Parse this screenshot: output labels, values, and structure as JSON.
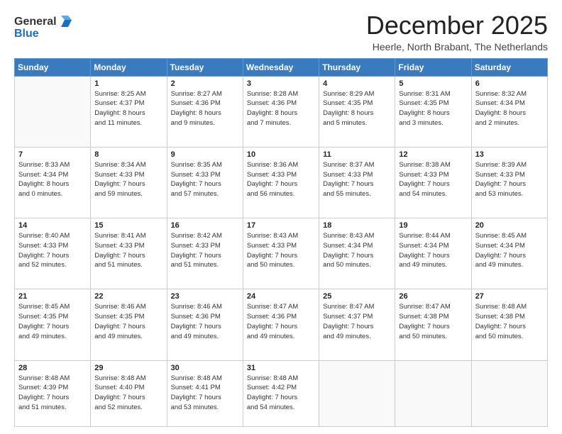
{
  "header": {
    "logo_general": "General",
    "logo_blue": "Blue",
    "month_title": "December 2025",
    "location": "Heerle, North Brabant, The Netherlands"
  },
  "weekdays": [
    "Sunday",
    "Monday",
    "Tuesday",
    "Wednesday",
    "Thursday",
    "Friday",
    "Saturday"
  ],
  "weeks": [
    [
      {
        "day": "",
        "info": ""
      },
      {
        "day": "1",
        "info": "Sunrise: 8:25 AM\nSunset: 4:37 PM\nDaylight: 8 hours\nand 11 minutes."
      },
      {
        "day": "2",
        "info": "Sunrise: 8:27 AM\nSunset: 4:36 PM\nDaylight: 8 hours\nand 9 minutes."
      },
      {
        "day": "3",
        "info": "Sunrise: 8:28 AM\nSunset: 4:36 PM\nDaylight: 8 hours\nand 7 minutes."
      },
      {
        "day": "4",
        "info": "Sunrise: 8:29 AM\nSunset: 4:35 PM\nDaylight: 8 hours\nand 5 minutes."
      },
      {
        "day": "5",
        "info": "Sunrise: 8:31 AM\nSunset: 4:35 PM\nDaylight: 8 hours\nand 3 minutes."
      },
      {
        "day": "6",
        "info": "Sunrise: 8:32 AM\nSunset: 4:34 PM\nDaylight: 8 hours\nand 2 minutes."
      }
    ],
    [
      {
        "day": "7",
        "info": "Sunrise: 8:33 AM\nSunset: 4:34 PM\nDaylight: 8 hours\nand 0 minutes."
      },
      {
        "day": "8",
        "info": "Sunrise: 8:34 AM\nSunset: 4:33 PM\nDaylight: 7 hours\nand 59 minutes."
      },
      {
        "day": "9",
        "info": "Sunrise: 8:35 AM\nSunset: 4:33 PM\nDaylight: 7 hours\nand 57 minutes."
      },
      {
        "day": "10",
        "info": "Sunrise: 8:36 AM\nSunset: 4:33 PM\nDaylight: 7 hours\nand 56 minutes."
      },
      {
        "day": "11",
        "info": "Sunrise: 8:37 AM\nSunset: 4:33 PM\nDaylight: 7 hours\nand 55 minutes."
      },
      {
        "day": "12",
        "info": "Sunrise: 8:38 AM\nSunset: 4:33 PM\nDaylight: 7 hours\nand 54 minutes."
      },
      {
        "day": "13",
        "info": "Sunrise: 8:39 AM\nSunset: 4:33 PM\nDaylight: 7 hours\nand 53 minutes."
      }
    ],
    [
      {
        "day": "14",
        "info": "Sunrise: 8:40 AM\nSunset: 4:33 PM\nDaylight: 7 hours\nand 52 minutes."
      },
      {
        "day": "15",
        "info": "Sunrise: 8:41 AM\nSunset: 4:33 PM\nDaylight: 7 hours\nand 51 minutes."
      },
      {
        "day": "16",
        "info": "Sunrise: 8:42 AM\nSunset: 4:33 PM\nDaylight: 7 hours\nand 51 minutes."
      },
      {
        "day": "17",
        "info": "Sunrise: 8:43 AM\nSunset: 4:33 PM\nDaylight: 7 hours\nand 50 minutes."
      },
      {
        "day": "18",
        "info": "Sunrise: 8:43 AM\nSunset: 4:34 PM\nDaylight: 7 hours\nand 50 minutes."
      },
      {
        "day": "19",
        "info": "Sunrise: 8:44 AM\nSunset: 4:34 PM\nDaylight: 7 hours\nand 49 minutes."
      },
      {
        "day": "20",
        "info": "Sunrise: 8:45 AM\nSunset: 4:34 PM\nDaylight: 7 hours\nand 49 minutes."
      }
    ],
    [
      {
        "day": "21",
        "info": "Sunrise: 8:45 AM\nSunset: 4:35 PM\nDaylight: 7 hours\nand 49 minutes."
      },
      {
        "day": "22",
        "info": "Sunrise: 8:46 AM\nSunset: 4:35 PM\nDaylight: 7 hours\nand 49 minutes."
      },
      {
        "day": "23",
        "info": "Sunrise: 8:46 AM\nSunset: 4:36 PM\nDaylight: 7 hours\nand 49 minutes."
      },
      {
        "day": "24",
        "info": "Sunrise: 8:47 AM\nSunset: 4:36 PM\nDaylight: 7 hours\nand 49 minutes."
      },
      {
        "day": "25",
        "info": "Sunrise: 8:47 AM\nSunset: 4:37 PM\nDaylight: 7 hours\nand 49 minutes."
      },
      {
        "day": "26",
        "info": "Sunrise: 8:47 AM\nSunset: 4:38 PM\nDaylight: 7 hours\nand 50 minutes."
      },
      {
        "day": "27",
        "info": "Sunrise: 8:48 AM\nSunset: 4:38 PM\nDaylight: 7 hours\nand 50 minutes."
      }
    ],
    [
      {
        "day": "28",
        "info": "Sunrise: 8:48 AM\nSunset: 4:39 PM\nDaylight: 7 hours\nand 51 minutes."
      },
      {
        "day": "29",
        "info": "Sunrise: 8:48 AM\nSunset: 4:40 PM\nDaylight: 7 hours\nand 52 minutes."
      },
      {
        "day": "30",
        "info": "Sunrise: 8:48 AM\nSunset: 4:41 PM\nDaylight: 7 hours\nand 53 minutes."
      },
      {
        "day": "31",
        "info": "Sunrise: 8:48 AM\nSunset: 4:42 PM\nDaylight: 7 hours\nand 54 minutes."
      },
      {
        "day": "",
        "info": ""
      },
      {
        "day": "",
        "info": ""
      },
      {
        "day": "",
        "info": ""
      }
    ]
  ]
}
